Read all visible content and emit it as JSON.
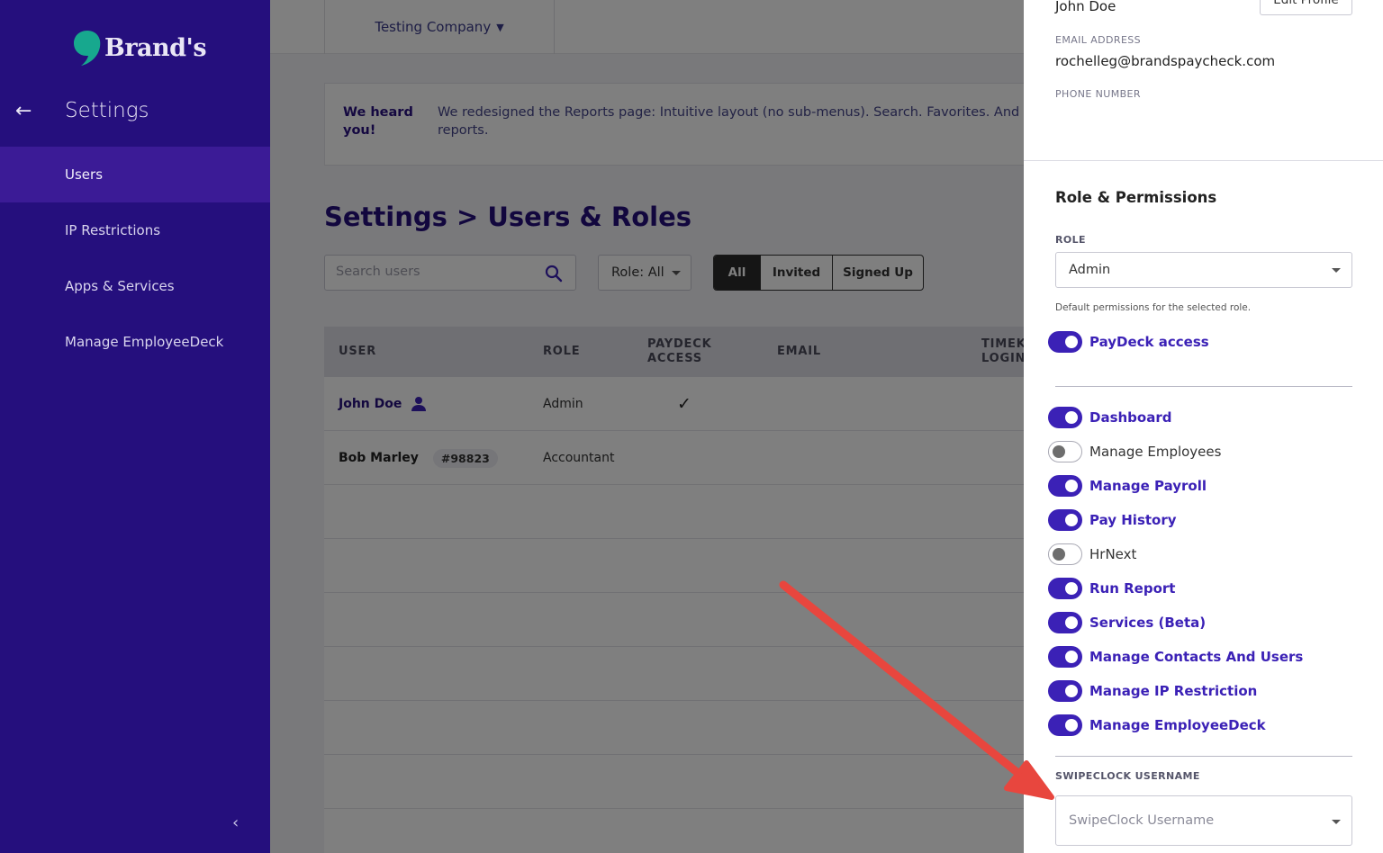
{
  "sidebar": {
    "logo_text": "Brand's",
    "title": "Settings",
    "items": [
      {
        "label": "Users",
        "active": true
      },
      {
        "label": "IP Restrictions",
        "active": false
      },
      {
        "label": "Apps & Services",
        "active": false
      },
      {
        "label": "Manage EmployeeDeck",
        "active": false
      }
    ]
  },
  "topbar": {
    "company": "Testing Company"
  },
  "banner": {
    "title": "We heard you!",
    "text": "We redesigned the Reports page: Intuitive layout (no sub-menus). Search. Favorites. And combined reports including PPX live reports."
  },
  "page": {
    "title": "Settings > Users & Roles",
    "search_placeholder": "Search users",
    "role_filter": "Role: All",
    "status_tabs": [
      "All",
      "Invited",
      "Signed Up"
    ],
    "active_tab": "All"
  },
  "table": {
    "columns": [
      "USER",
      "ROLE",
      "PAYDECK ACCESS",
      "EMAIL",
      "TIMEKEEPING LOGIN"
    ],
    "rows": [
      {
        "user": "John Doe",
        "badge": "",
        "role": "Admin",
        "paydeck": "✓"
      },
      {
        "user": "Bob Marley",
        "badge": "#98823",
        "role": "Accountant",
        "paydeck": ""
      }
    ]
  },
  "panel": {
    "name": "John Doe",
    "edit_button": "Edit Profile",
    "email_label": "EMAIL ADDRESS",
    "email": "rochelleg@brandspaycheck.com",
    "phone_label": "PHONE NUMBER",
    "section_title": "Role & Permissions",
    "role_label": "ROLE",
    "role_value": "Admin",
    "role_hint": "Default permissions for the selected role.",
    "paydeck_access": {
      "label": "PayDeck access",
      "enabled": true
    },
    "permissions": [
      {
        "label": "Dashboard",
        "enabled": true
      },
      {
        "label": "Manage Employees",
        "enabled": false
      },
      {
        "label": "Manage Payroll",
        "enabled": true
      },
      {
        "label": "Pay History",
        "enabled": true
      },
      {
        "label": "HrNext",
        "enabled": false
      },
      {
        "label": "Run Report",
        "enabled": true
      },
      {
        "label": "Services (Beta)",
        "enabled": true
      },
      {
        "label": "Manage Contacts And Users",
        "enabled": true
      },
      {
        "label": "Manage IP Restriction",
        "enabled": true
      },
      {
        "label": "Manage EmployeeDeck",
        "enabled": true
      }
    ],
    "swipeclock_label": "SWIPECLOCK USERNAME",
    "swipeclock_placeholder": "SwipeClock Username"
  },
  "colors": {
    "sidebar_bg": "#250f7d",
    "sidebar_active": "#3b1b96",
    "accent": "#3b21b6",
    "logo_mark": "#17a88e",
    "annotation_arrow": "#e8463e"
  },
  "icons": [
    "back-arrow-icon",
    "chevron-down-icon",
    "search-icon",
    "person-icon",
    "checkmark-icon",
    "collapse-chevron-icon",
    "caret-down-icon"
  ]
}
